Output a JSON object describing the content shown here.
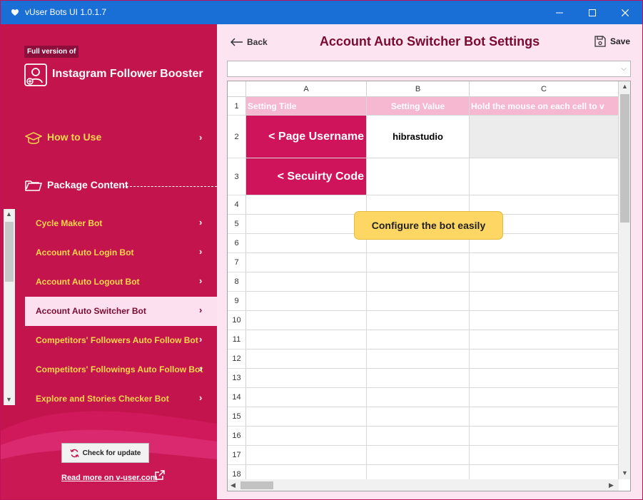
{
  "window": {
    "title": "vUser Bots UI 1.0.1.7"
  },
  "sidebar": {
    "badge": "Full version of",
    "product_title": "Instagram Follower Booster",
    "how_to_use": "How to Use",
    "package_content": "Package Content",
    "items": [
      {
        "label": "Cycle Maker Bot",
        "active": false
      },
      {
        "label": "Account Auto Login Bot",
        "active": false
      },
      {
        "label": "Account Auto Logout Bot",
        "active": false
      },
      {
        "label": "Account Auto Switcher Bot",
        "active": true
      },
      {
        "label": "Competitors' Followers Auto Follow Bot",
        "active": false
      },
      {
        "label": "Competitors' Followings Auto Follow Bot",
        "active": false
      },
      {
        "label": "Explore and Stories Checker Bot",
        "active": false
      }
    ],
    "check_update": "Check for update",
    "read_more": "Read more on v-user.com"
  },
  "main": {
    "back_label": "Back",
    "title": "Account Auto Switcher Bot Settings",
    "save_label": "Save",
    "combo_value": "",
    "sheet": {
      "columns": [
        "A",
        "B",
        "C"
      ],
      "header_row": [
        "Setting Title",
        "Setting Value",
        "Hold the mouse on each cell to v"
      ],
      "rows": [
        {
          "title": "< Page Username",
          "value": "hibrastudio"
        },
        {
          "title": "< Secuirty Code",
          "value": ""
        }
      ],
      "row_numbers": [
        "1",
        "2",
        "3",
        "4",
        "5",
        "6",
        "7",
        "8",
        "9",
        "10",
        "11",
        "12",
        "13",
        "14",
        "15",
        "16",
        "17",
        "18"
      ]
    },
    "tooltip": "Configure the bot easily"
  },
  "colors": {
    "titlebar": "#1a6fd6",
    "sidebar": "#c4144d",
    "accent_text": "#ffd84d",
    "active_item_bg": "#fde0ef",
    "main_bg": "#fde4f1",
    "title_color": "#7b0a2e",
    "setting_cell": "#d0145b",
    "header_row": "#f6b8d1",
    "tooltip": "#fdd663"
  }
}
